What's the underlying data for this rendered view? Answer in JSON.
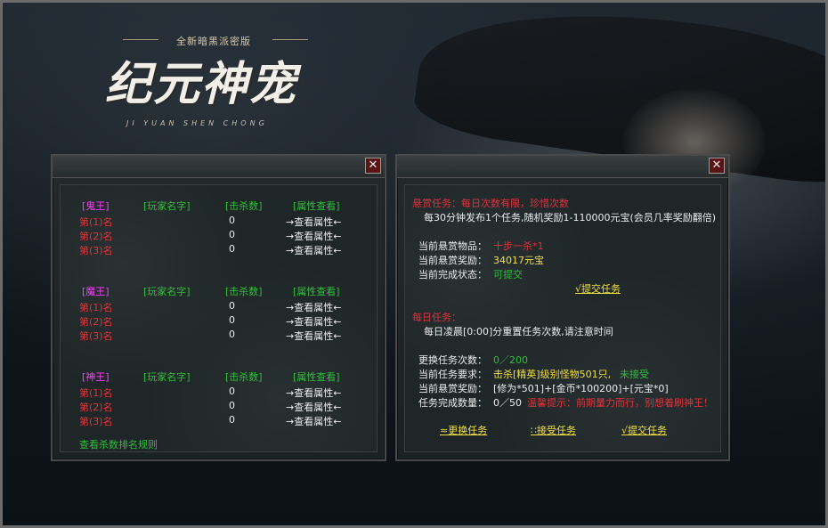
{
  "logo": {
    "subtitle": "全新暗黑派密版",
    "title": "纪元神宠",
    "pinyin": "JI YUAN SHEN CHONG"
  },
  "rank_panel": {
    "groups": [
      {
        "title": "[鬼王]",
        "headers": [
          "[玩家名字]",
          "[击杀数]",
          "[属性查看]"
        ],
        "rows": [
          {
            "rank": "第(1)名",
            "kills": "0",
            "action": "→查看属性←"
          },
          {
            "rank": "第(2)名",
            "kills": "0",
            "action": "→查看属性←"
          },
          {
            "rank": "第(3)名",
            "kills": "0",
            "action": "→查看属性←"
          }
        ]
      },
      {
        "title": "[魔王]",
        "headers": [
          "[玩家名字]",
          "[击杀数]",
          "[属性查看]"
        ],
        "rows": [
          {
            "rank": "第(1)名",
            "kills": "0",
            "action": "→查看属性←"
          },
          {
            "rank": "第(2)名",
            "kills": "0",
            "action": "→查看属性←"
          },
          {
            "rank": "第(3)名",
            "kills": "0",
            "action": "→查看属性←"
          }
        ]
      },
      {
        "title": "[神王]",
        "headers": [
          "[玩家名字]",
          "[击杀数]",
          "[属性查看]"
        ],
        "rows": [
          {
            "rank": "第(1)名",
            "kills": "0",
            "action": "→查看属性←"
          },
          {
            "rank": "第(2)名",
            "kills": "0",
            "action": "→查看属性←"
          },
          {
            "rank": "第(3)名",
            "kills": "0",
            "action": "→查看属性←"
          }
        ]
      }
    ],
    "rules_link": "查看杀数排名规则"
  },
  "task_panel": {
    "bounty_header": "悬赏任务：每日次数有限，珍惜次数",
    "bounty_desc": "每30分钟发布1个任务,随机奖励1-110000元宝(会员几率奖励翻倍)",
    "current_item_label": "当前悬赏物品：",
    "current_item_value": "十步一杀*1",
    "current_reward_label": "当前悬赏奖励：",
    "current_reward_value": "34017元宝",
    "current_status_label": "当前完成状态：",
    "current_status_value": "可提交",
    "submit_bounty": "√提交任务",
    "daily_header": "每日任务：",
    "daily_desc": "每日凌晨[0:00]分重置任务次数,请注意时间",
    "refresh_count_label": "更换任务次数：",
    "refresh_count_value": "0／200",
    "requirement_label": "当前任务要求：",
    "requirement_value": "击杀[精英]级别怪物501只,",
    "requirement_status": "未接受",
    "daily_reward_label": "当前悬赏奖励：",
    "daily_reward_value": "[修为*501]+[金币*100200]+[元宝*0]",
    "complete_count_label": "任务完成数量：",
    "complete_count_value": "0／50",
    "tip": "温馨提示：前期量力而行，别想着刷神王！",
    "btn_change": "≈更换任务",
    "btn_accept": "∷接受任务",
    "btn_submit": "√提交任务"
  },
  "icons": {
    "close": "close-icon"
  }
}
